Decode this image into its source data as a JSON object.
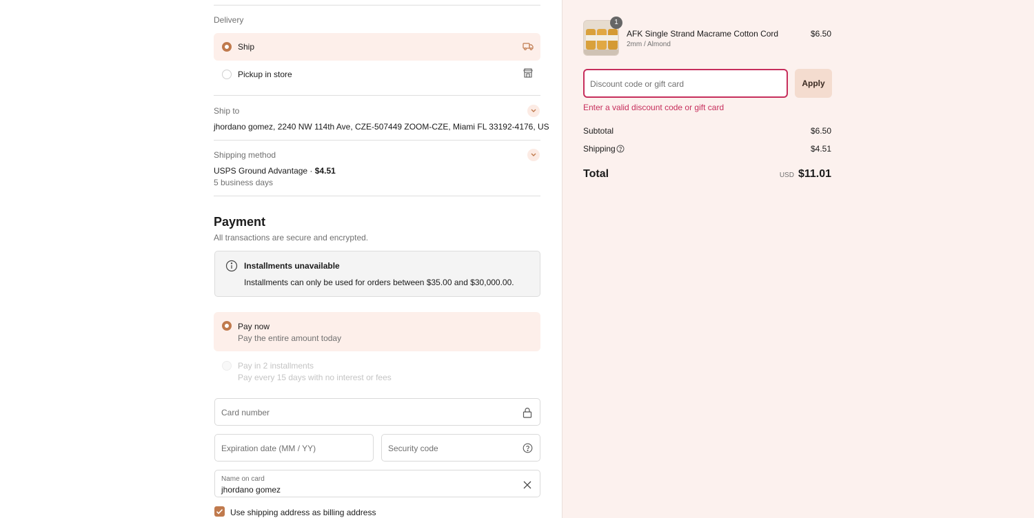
{
  "delivery": {
    "label": "Delivery",
    "options": [
      {
        "label": "Ship",
        "selected": true,
        "icon": "truck-icon"
      },
      {
        "label": "Pickup in store",
        "selected": false,
        "icon": "store-icon"
      }
    ]
  },
  "ship_to": {
    "label": "Ship to",
    "address": "jhordano gomez, 2240 NW 114th Ave, CZE-507449 ZOOM-CZE, Miami FL 33192-4176, US"
  },
  "shipping_method": {
    "label": "Shipping method",
    "name": "USPS Ground Advantage · ",
    "price": "$4.51",
    "eta": "5 business days"
  },
  "payment": {
    "title": "Payment",
    "subtitle": "All transactions are secure and encrypted.",
    "notice_title": "Installments unavailable",
    "notice_body": "Installments can only be used for orders between $35.00 and $30,000.00.",
    "options": [
      {
        "label": "Pay now",
        "sub": "Pay the entire amount today",
        "selected": true,
        "disabled": false
      },
      {
        "label": "Pay in 2 installments",
        "sub": "Pay every 15 days with no interest or fees",
        "selected": false,
        "disabled": true
      }
    ],
    "card_number_placeholder": "Card number",
    "expiration_placeholder": "Expiration date (MM / YY)",
    "security_placeholder": "Security code",
    "name_label": "Name on card",
    "name_value": "jhordano gomez",
    "billing_checkbox_label": "Use shipping address as billing address",
    "billing_checked": true
  },
  "summary": {
    "item": {
      "name": "AFK Single Strand Macrame Cotton Cord",
      "variant": "2mm / Almond",
      "price": "$6.50",
      "quantity": "1"
    },
    "discount_placeholder": "Discount code or gift card",
    "apply_label": "Apply",
    "error": "Enter a valid discount code or gift card",
    "subtotal_label": "Subtotal",
    "subtotal": "$6.50",
    "shipping_label": "Shipping",
    "shipping": "$4.51",
    "total_label": "Total",
    "currency": "USD",
    "total": "$11.01"
  },
  "colors": {
    "accent": "#c07a4d",
    "error": "#c62d5b",
    "selected_bg": "#fdefea",
    "aside_bg": "#fcf1ee"
  }
}
